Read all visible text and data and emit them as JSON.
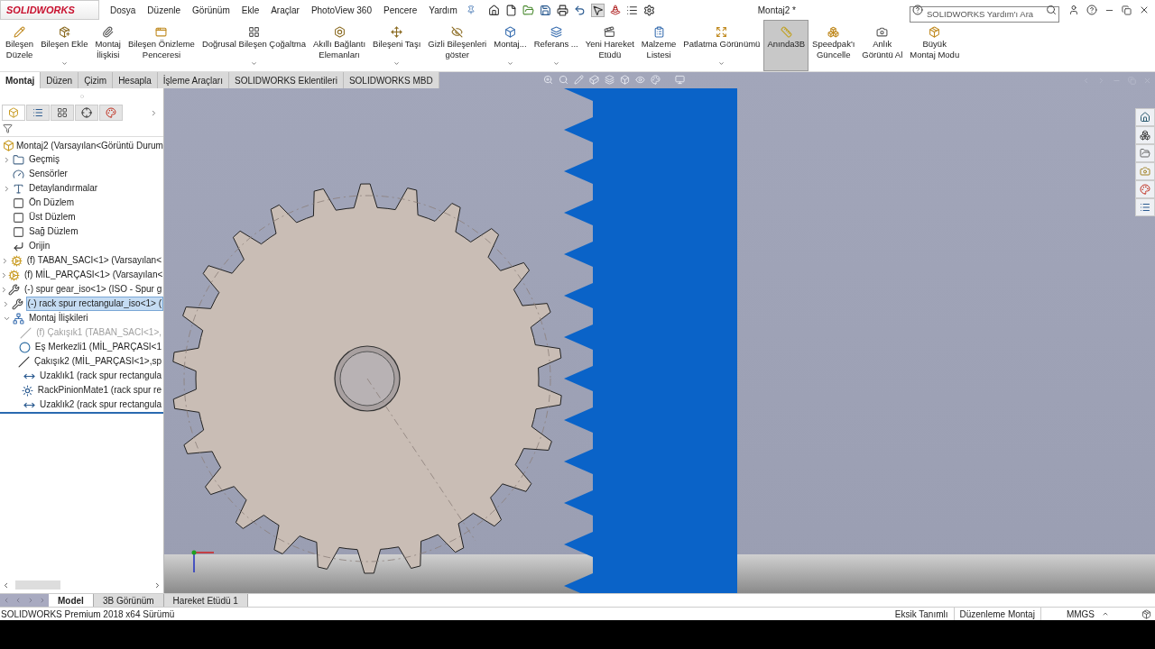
{
  "title_bar": {
    "logo": "SOLIDWORKS",
    "menu": [
      "Dosya",
      "Düzenle",
      "Görünüm",
      "Ekle",
      "Araçlar",
      "PhotoView 360",
      "Pencere",
      "Yardım"
    ],
    "document_title": "Montaj2 *",
    "search": {
      "placeholder": "SOLIDWORKS Yardım'ı Ara"
    }
  },
  "ribbon": [
    {
      "label": "Bileşen\nDüzele",
      "dropdown": false,
      "selected": false
    },
    {
      "label": "Bileşen Ekle",
      "dropdown": true,
      "selected": false
    },
    {
      "label": "Montaj\nİlişkisi",
      "dropdown": false,
      "selected": false
    },
    {
      "label": "Bileşen Önizleme\nPenceresi",
      "dropdown": false,
      "selected": false
    },
    {
      "label": "Doğrusal Bileşen Çoğaltma",
      "dropdown": true,
      "selected": false
    },
    {
      "label": "Akıllı Bağlantı\nElemanları",
      "dropdown": false,
      "selected": false
    },
    {
      "label": "Bileşeni Taşı",
      "dropdown": true,
      "selected": false
    },
    {
      "label": "Gizli Bileşenleri\ngöster",
      "dropdown": false,
      "selected": false
    },
    {
      "label": "Montaj...",
      "dropdown": true,
      "selected": false
    },
    {
      "label": "Referans ...",
      "dropdown": true,
      "selected": false
    },
    {
      "label": "Yeni Hareket\nEtüdü",
      "dropdown": false,
      "selected": false
    },
    {
      "label": "Malzeme\nListesi",
      "dropdown": false,
      "selected": false
    },
    {
      "label": "Patlatma Görünümü",
      "dropdown": true,
      "selected": false
    },
    {
      "label": "Anında3B",
      "dropdown": false,
      "selected": true
    },
    {
      "label": "Speedpak'ı\nGüncelle",
      "dropdown": false,
      "selected": false
    },
    {
      "label": "Anlık\nGörüntü Al",
      "dropdown": false,
      "selected": false
    },
    {
      "label": "Büyük\nMontaj Modu",
      "dropdown": false,
      "selected": false
    }
  ],
  "command_tabs": [
    {
      "label": "Montaj",
      "selected": true
    },
    {
      "label": "Düzen",
      "selected": false
    },
    {
      "label": "Çizim",
      "selected": false
    },
    {
      "label": "Hesapla",
      "selected": false
    },
    {
      "label": "İşleme Araçları",
      "selected": false
    },
    {
      "label": "SOLIDWORKS Eklentileri",
      "selected": false
    },
    {
      "label": "SOLIDWORKS MBD",
      "selected": false
    }
  ],
  "feature_tree": {
    "root": "Montaj2  (Varsayılan<Görüntü Durum",
    "items": [
      {
        "kind": "history",
        "label": "Geçmiş",
        "expanded": false,
        "selected": false
      },
      {
        "kind": "sensor",
        "label": "Sensörler",
        "selected": false
      },
      {
        "kind": "annotation",
        "label": "Detaylandırmalar",
        "expanded": false,
        "selected": false
      },
      {
        "kind": "plane",
        "label": "Ön Düzlem",
        "selected": false
      },
      {
        "kind": "plane",
        "label": "Üst Düzlem",
        "selected": false
      },
      {
        "kind": "plane",
        "label": "Sağ Düzlem",
        "selected": false
      },
      {
        "kind": "origin",
        "label": "Orijin",
        "selected": false
      },
      {
        "kind": "part",
        "label": "(f) TABAN_SACI<1> (Varsayılan<",
        "expanded": false,
        "selected": false
      },
      {
        "kind": "part",
        "label": "(f) MİL_PARÇASI<1> (Varsayılan<",
        "expanded": false,
        "selected": false
      },
      {
        "kind": "toolbox",
        "label": "(-) spur gear_iso<1> (ISO - Spur g",
        "expanded": false,
        "selected": false
      },
      {
        "kind": "toolbox",
        "label": "(-) rack spur rectangular_iso<1> (",
        "expanded": false,
        "selected": true
      },
      {
        "kind": "mates",
        "label": "Montaj İlişkileri",
        "expanded": true,
        "selected": false,
        "children": [
          {
            "kind": "coincident",
            "label": "(f) Çakışık1 (TABAN_SACI<1>,",
            "selected": false,
            "disabled": true
          },
          {
            "kind": "concentric",
            "label": "Eş Merkezli1 (MİL_PARÇASI<1",
            "selected": false,
            "disabled": false
          },
          {
            "kind": "coincident",
            "label": "Çakışık2 (MİL_PARÇASI<1>,sp",
            "selected": false,
            "disabled": false
          },
          {
            "kind": "distance",
            "label": "Uzaklık1 (rack spur rectangula",
            "selected": false,
            "disabled": false
          },
          {
            "kind": "rack",
            "label": "RackPinionMate1 (rack spur re",
            "selected": false,
            "disabled": false
          },
          {
            "kind": "distance",
            "label": "Uzaklık2 (rack spur rectangula",
            "selected": false,
            "disabled": false
          }
        ]
      }
    ]
  },
  "bottom_tabs": [
    {
      "label": "Model",
      "selected": true
    },
    {
      "label": "3B Görünüm",
      "selected": false
    },
    {
      "label": "Hareket Etüdü 1",
      "selected": false
    }
  ],
  "status_bar": {
    "version": "SOLIDWORKS Premium 2018 x64 Sürümü",
    "items": [
      "Eksik Tanımlı",
      "Düzenleme Montaj"
    ],
    "units": "MMGS"
  }
}
